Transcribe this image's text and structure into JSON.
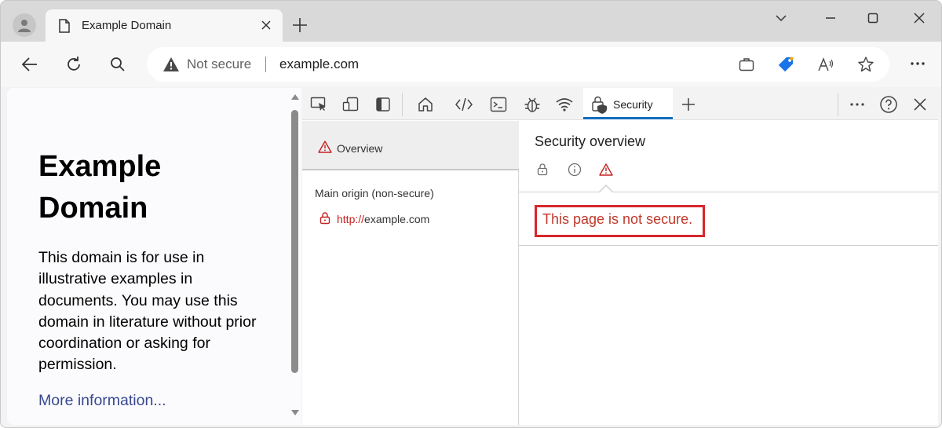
{
  "browser": {
    "tab": {
      "title": "Example Domain"
    },
    "address_bar": {
      "security_label": "Not secure",
      "url": "example.com"
    },
    "icons": {
      "profile": "profile-avatar-icon",
      "tab": "document-icon",
      "back": "back-arrow-icon",
      "refresh": "refresh-icon",
      "search": "search-icon",
      "warning": "warning-triangle-icon"
    }
  },
  "page": {
    "heading": "Example Domain",
    "paragraph": "This domain is for use in illustrative examples in documents. You may use this domain in literature without prior coordination or asking for permission.",
    "link": "More information..."
  },
  "devtools": {
    "active_tab": "Security",
    "sidebar": {
      "overview_label": "Overview",
      "origin_heading": "Main origin (non-secure)",
      "origin_scheme": "http://",
      "origin_host": "example.com"
    },
    "panel": {
      "title": "Security overview",
      "message": "This page is not secure."
    }
  },
  "colors": {
    "warning": "#c5221f",
    "link": "#38488f",
    "tab_underline": "#0f6cbd",
    "highlight_box": "#d6272d"
  }
}
